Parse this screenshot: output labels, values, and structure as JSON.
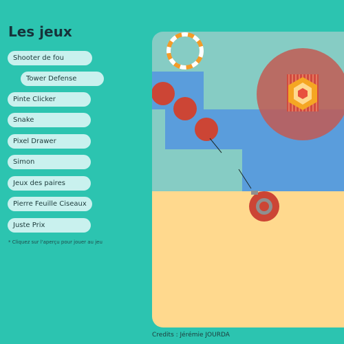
{
  "title": "Les jeux",
  "menu": [
    {
      "label": "Shooter de fou"
    },
    {
      "label": "Tower Defense"
    },
    {
      "label": "Pinte Clicker"
    },
    {
      "label": "Snake"
    },
    {
      "label": "Pixel Drawer"
    },
    {
      "label": "Simon"
    },
    {
      "label": "Jeux des paires"
    },
    {
      "label": "Pierre Feuille Ciseaux"
    },
    {
      "label": "Juste Prix"
    }
  ],
  "hint": "* Cliquez sur l'aperçu pour jouer au jeu",
  "credits": "Credits : Jérémie JOURDA",
  "colors": {
    "background": "#2cc4b0",
    "menu_item": "#c9f1ee",
    "preview_grass": "#86ccc4",
    "preview_path": "#5a9ddc",
    "preview_sand": "#ffd98e",
    "enemy": "#cc4535",
    "range": "#c25a53",
    "tower": "#f5a623",
    "ring_orange": "#f39c28",
    "ring_white": "#ffffff"
  }
}
